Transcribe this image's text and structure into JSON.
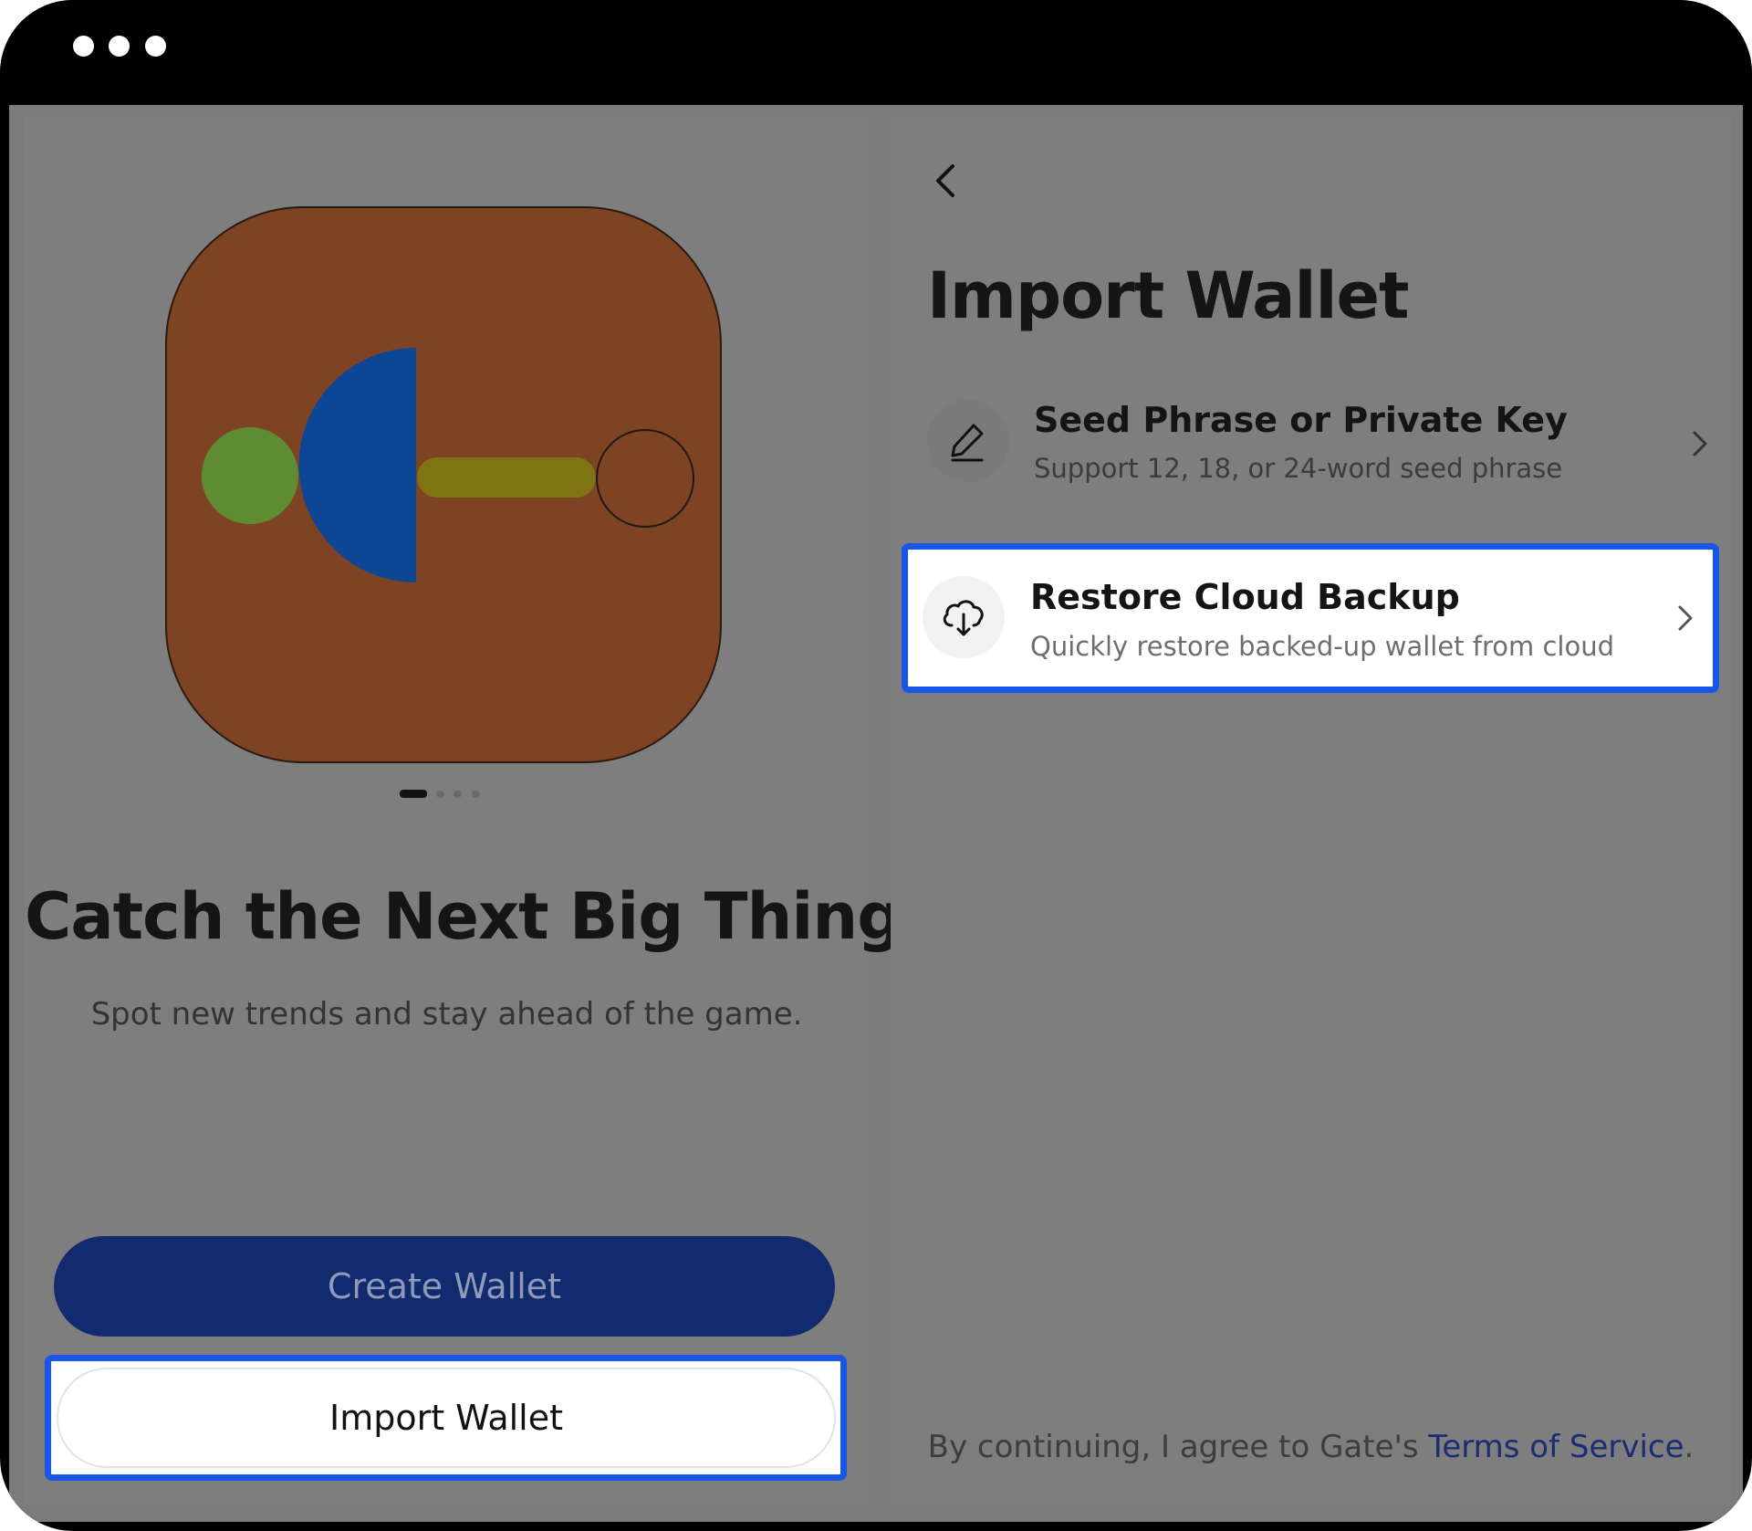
{
  "window": {
    "controls": [
      "dot",
      "dot",
      "dot"
    ]
  },
  "onboarding": {
    "headline": "Catch the Next Big Thing",
    "subline": "Spot new trends and stay ahead of the game.",
    "create_label": "Create Wallet",
    "import_label": "Import Wallet",
    "pager": {
      "count": 4,
      "active": 1
    }
  },
  "import": {
    "title": "Import Wallet",
    "options": [
      {
        "title": "Seed Phrase or Private Key",
        "desc": "Support 12, 18, or 24-word seed phrase",
        "icon": "pen-icon"
      },
      {
        "title": "Restore Cloud Backup",
        "desc": "Quickly restore backed-up wallet from cloud",
        "icon": "cloud-download-icon"
      }
    ],
    "terms_prefix": "By continuing, I agree to Gate's ",
    "terms_link": "Terms of Service",
    "terms_suffix": "."
  },
  "colors": {
    "highlight": "#1856e8",
    "primary_button": "#122a6e",
    "icon_bg": "#7e4323",
    "icon_blue": "#0d4694",
    "icon_green": "#5f8c33",
    "icon_yellow": "#7e7413"
  }
}
